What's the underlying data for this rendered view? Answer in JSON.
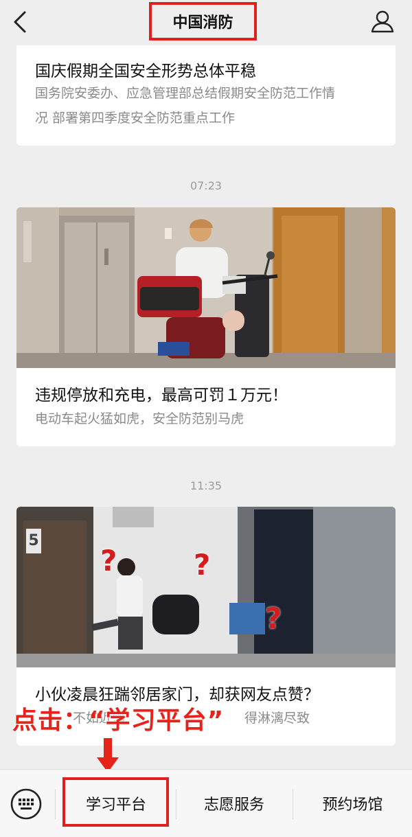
{
  "header": {
    "title": "中国消防"
  },
  "feed": [
    {
      "headline": "国庆假期全国安全形势总体平稳",
      "summary_line1": "国务院安委办、应急管理部总结假期安全防范工作情",
      "summary_line2": "况 部署第四季度安全防范重点工作"
    },
    {
      "time": "07:23",
      "headline": "违规停放和充电，最高可罚１万元！",
      "summary": "电动车起火猛如虎，安全防范别马虎"
    },
    {
      "time": "11:35",
      "headline": "小伙凌晨狂踹邻居家门，却获网友点赞？",
      "summary_visible_left": "不如近邻",
      "summary_visible_right": "得淋漓尽致",
      "image_marks": [
        "?",
        "?",
        "?"
      ],
      "floor_number": "5"
    }
  ],
  "annotation": {
    "text": "点击：“学习平台”"
  },
  "bottom_menu": {
    "items": [
      "学习平台",
      "志愿服务",
      "预约场馆"
    ]
  },
  "colors": {
    "highlight": "#e01f1f",
    "background": "#eeeeee"
  },
  "icons": [
    "back-arrow-icon",
    "user-icon",
    "keyboard-icon",
    "arrow-down-icon"
  ]
}
